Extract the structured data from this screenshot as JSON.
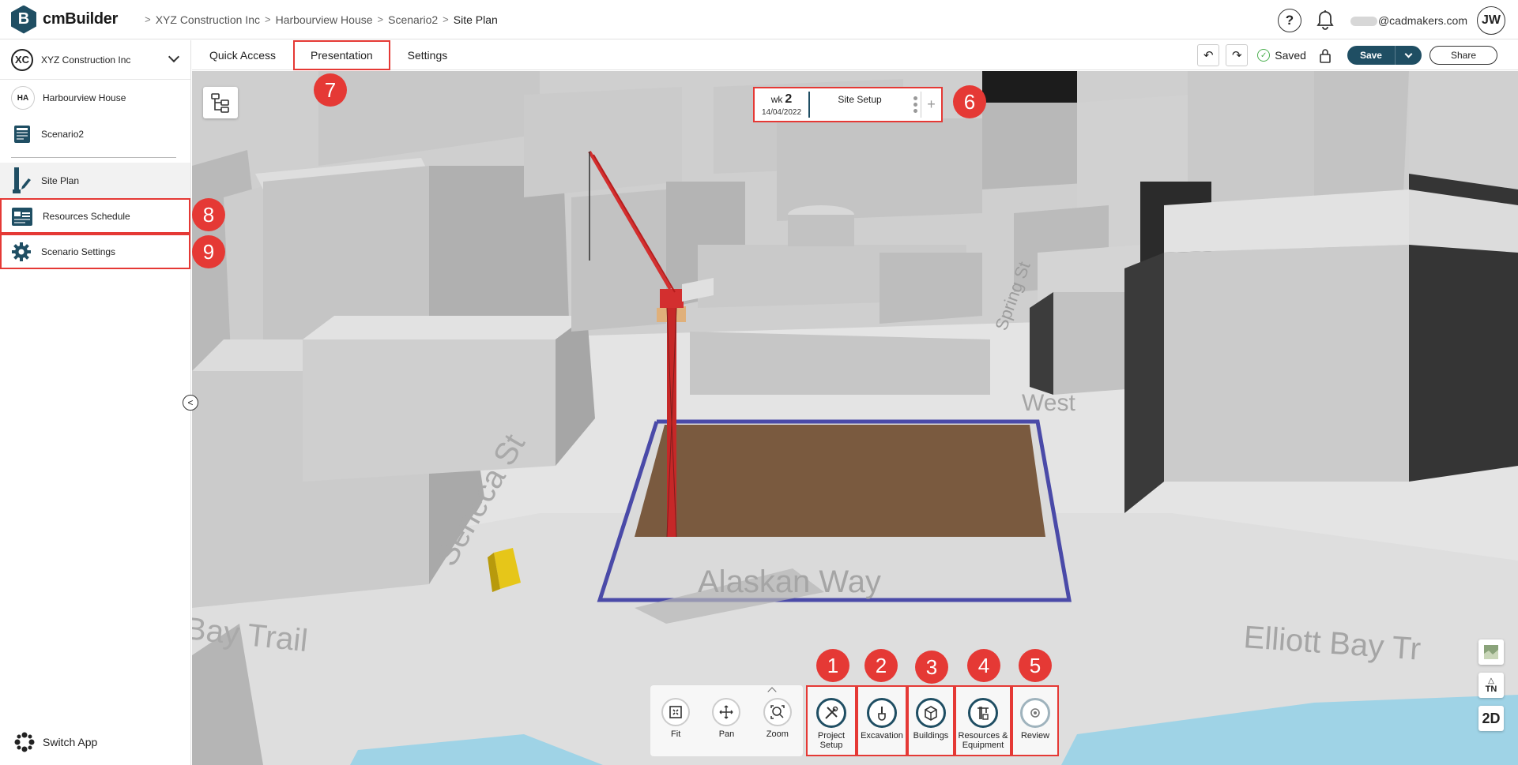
{
  "app": {
    "name": "cmBuilder",
    "logo_letter": "B"
  },
  "breadcrumb": [
    "XYZ Construction Inc",
    "Harbourview House",
    "Scenario2",
    "Site Plan"
  ],
  "header": {
    "help": "?",
    "email": "@cadmakers.com",
    "avatar_initials": "JW"
  },
  "sidebar": {
    "org": {
      "initials": "XC",
      "name": "XYZ Construction Inc"
    },
    "project": {
      "initials": "HA",
      "name": "Harbourview House"
    },
    "scenario": {
      "name": "Scenario2"
    },
    "nav": [
      {
        "label": "Site Plan"
      },
      {
        "label": "Resources Schedule"
      },
      {
        "label": "Scenario Settings"
      }
    ],
    "switch_app": "Switch App"
  },
  "toolbar": {
    "tabs": [
      "Quick Access",
      "Presentation",
      "Settings"
    ],
    "status": "Saved",
    "save_label": "Save",
    "share_label": "Share"
  },
  "timeline": {
    "wk_label": "wk",
    "wk_number": "2",
    "date": "14/04/2022",
    "phase": "Site Setup",
    "add": "+"
  },
  "view_tools": [
    {
      "label": "Fit",
      "icon": "fit-icon"
    },
    {
      "label": "Pan",
      "icon": "pan-icon"
    },
    {
      "label": "Zoom",
      "icon": "zoom-icon"
    }
  ],
  "steps": [
    {
      "label": "Project Setup",
      "icon": "tools-icon"
    },
    {
      "label": "Excavation",
      "icon": "shovel-icon"
    },
    {
      "label": "Buildings",
      "icon": "building-icon"
    },
    {
      "label": "Resources & Equipment",
      "icon": "crane-icon"
    },
    {
      "label": "Review",
      "icon": "review-icon"
    }
  ],
  "map_controls": {
    "north": "TN",
    "mode": "2D"
  },
  "map_labels": [
    "Seneca St",
    "Alaskan Way",
    "Elliott Bay Tr",
    "Bay Trail",
    "West",
    "Spring St"
  ],
  "annotations": [
    "1",
    "2",
    "3",
    "4",
    "5",
    "6",
    "7",
    "8",
    "9"
  ],
  "colors": {
    "brand": "#1f4e63",
    "highlight": "#e53935",
    "site": "#7a5a3f",
    "fence": "#4a4aa8",
    "crane": "#d32f2f"
  }
}
